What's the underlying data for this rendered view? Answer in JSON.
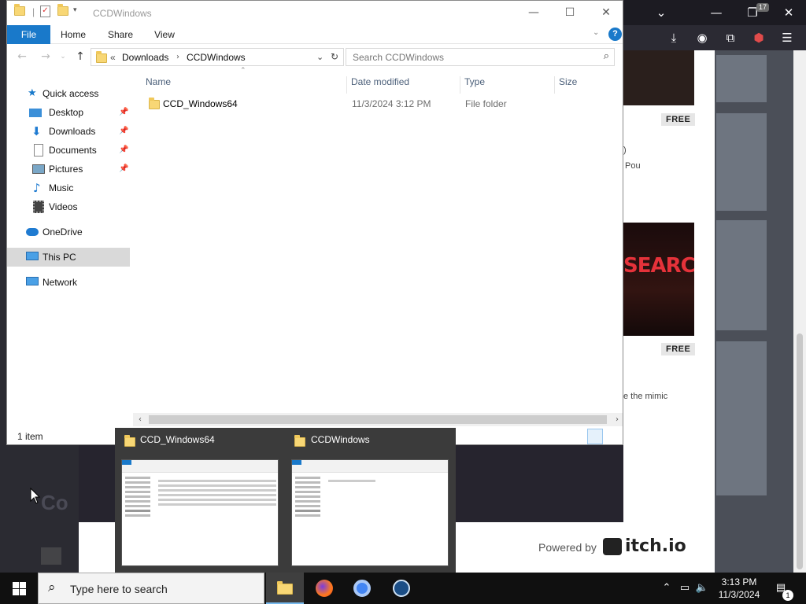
{
  "browser": {
    "extension_badge": "17",
    "free_label": "FREE",
    "snippet_1": ")",
    "snippet_2": "Pou",
    "snippet_3": "e the mimic",
    "art_word": "SEARCH",
    "footer_powered": "Powered by",
    "footer_logo": "itch.io",
    "partial_heading": "Co"
  },
  "explorer": {
    "title": "CCDWindows",
    "ribbon": {
      "file": "File",
      "home": "Home",
      "share": "Share",
      "view": "View",
      "help": "?"
    },
    "breadcrumb": [
      "Downloads",
      "CCDWindows"
    ],
    "breadcrumb_overflow": "«",
    "search_placeholder": "Search CCDWindows",
    "nav_items": [
      {
        "label": "Quick access",
        "icon": "star-icon"
      },
      {
        "label": "Desktop",
        "icon": "desktop-icon",
        "pinned": true
      },
      {
        "label": "Downloads",
        "icon": "download-arrow-icon",
        "pinned": true
      },
      {
        "label": "Documents",
        "icon": "document-icon",
        "pinned": true
      },
      {
        "label": "Pictures",
        "icon": "pictures-icon",
        "pinned": true
      },
      {
        "label": "Music",
        "icon": "music-note-icon"
      },
      {
        "label": "Videos",
        "icon": "film-icon"
      },
      {
        "label": "OneDrive",
        "icon": "cloud-icon"
      },
      {
        "label": "This PC",
        "icon": "monitor-icon",
        "selected": true
      },
      {
        "label": "Network",
        "icon": "network-icon"
      }
    ],
    "columns": {
      "name": "Name",
      "date": "Date modified",
      "type": "Type",
      "size": "Size"
    },
    "files": [
      {
        "name": "CCD_Windows64",
        "date": "11/3/2024 3:12 PM",
        "type": "File folder",
        "size": ""
      }
    ],
    "status": "1 item"
  },
  "preview": {
    "windows": [
      {
        "title": "CCD_Windows64"
      },
      {
        "title": "CCDWindows"
      }
    ]
  },
  "taskbar": {
    "search_placeholder": "Type here to search",
    "time": "3:13 PM",
    "date": "11/3/2024",
    "notification_count": "1"
  },
  "colors": {
    "accent": "#1979ca",
    "selection": "#d9d9d9",
    "folder": "#f8d775",
    "taskbar": "#101010"
  }
}
